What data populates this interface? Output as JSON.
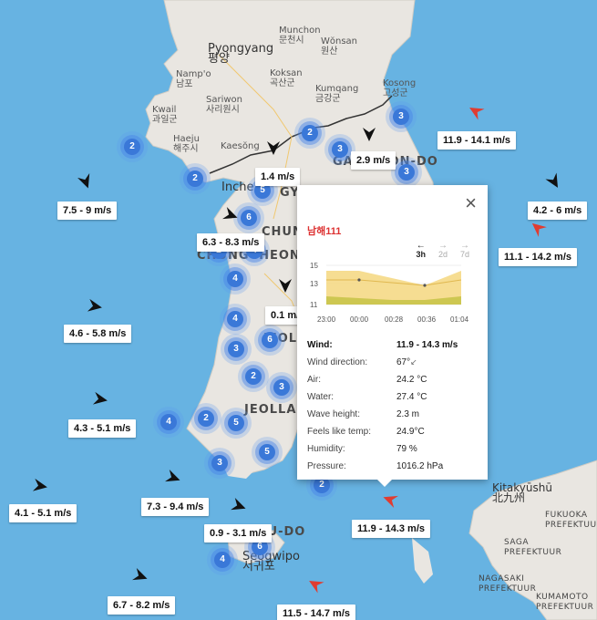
{
  "places": [
    {
      "id": "munchon",
      "text": "Munchon\n문천시",
      "cls": ""
    },
    {
      "id": "wonsan",
      "text": "Wŏnsan\n원산",
      "cls": ""
    },
    {
      "id": "pyongyang",
      "text": "Pyongyang\n평양",
      "cls": "big"
    },
    {
      "id": "nampo",
      "text": "Namp'o\n남포",
      "cls": ""
    },
    {
      "id": "koksan",
      "text": "Koksan\n곡산군",
      "cls": ""
    },
    {
      "id": "kosong",
      "text": "Kosong\n고성군",
      "cls": ""
    },
    {
      "id": "kwail",
      "text": "Kwail\n과일군",
      "cls": ""
    },
    {
      "id": "sariwon",
      "text": "Sariwon\n사리원시",
      "cls": ""
    },
    {
      "id": "kumgang",
      "text": "Kumqang\n금강군",
      "cls": ""
    },
    {
      "id": "haeju",
      "text": "Haeju\n해주시",
      "cls": ""
    },
    {
      "id": "kaesong",
      "text": "Kaesŏng",
      "cls": ""
    },
    {
      "id": "gangwon",
      "text": "GANGWON-DO",
      "cls": "region"
    },
    {
      "id": "incheon",
      "text": "Inche",
      "cls": "big"
    },
    {
      "id": "gyeonggi",
      "text": "GY",
      "cls": "region"
    },
    {
      "id": "chungcheong1",
      "text": "CHUN",
      "cls": "region"
    },
    {
      "id": "chungcheong2",
      "text": "CHUNGCHEONG",
      "cls": "region"
    },
    {
      "id": "jeolla1",
      "text": "JEOLL",
      "cls": "region"
    },
    {
      "id": "jeolla2",
      "text": "JEOLLAN",
      "cls": "region"
    },
    {
      "id": "jeju",
      "text": "JEJU-DO",
      "cls": "region"
    },
    {
      "id": "seogwipo",
      "text": "Seogwipo\n서귀포",
      "cls": "big"
    },
    {
      "id": "kitakyushu",
      "text": "Kitakyūshū\n北九州",
      "cls": "japan-city"
    },
    {
      "id": "fukuoka",
      "text": "FUKUOKA\nPREFEKTUUR",
      "cls": "japan"
    },
    {
      "id": "saga",
      "text": "SAGA\nPREFEKTUUR",
      "cls": "japan"
    },
    {
      "id": "nagasaki",
      "text": "NAGASAKI\nPREFEKTUUR",
      "cls": "japan"
    },
    {
      "id": "kumamoto",
      "text": "KUMAMOTO\nPREFEKTUUR",
      "cls": "japan"
    }
  ],
  "clusters": [
    "3",
    "2",
    "3",
    "2",
    "3",
    "2",
    "5",
    "6",
    "2",
    "4",
    "4",
    "4",
    "3",
    "6",
    "2",
    "3",
    "4",
    "2",
    "5",
    "3",
    "5",
    "2",
    "6",
    "4"
  ],
  "wind_labels": [
    "11.9 - 14.1 m/s",
    "2.9 m/s",
    "1.4 m/s",
    "7.5 - 9 m/s",
    "4.2 - 6 m/s",
    "6.3 - 8.3 m/s",
    "11.1 - 14.2 m/s",
    "0.1 m/s",
    "4.6 - 5.8 m/s",
    "4.3 - 5.1 m/s",
    "7.3 - 9.4 m/s",
    "4.1 - 5.1 m/s",
    "0.9 - 3.1 m/s",
    "11.9 - 14.3 m/s",
    "6.7 - 8.2 m/s",
    "11.5 - 14.7 m/s"
  ],
  "arrow_colors": {
    "normal": "#111111",
    "strong": "#e03c31"
  },
  "popup": {
    "title": "남해111",
    "close_icon": "×",
    "tabs": [
      {
        "arrow": "←",
        "label": "3h",
        "active": true
      },
      {
        "arrow": "→",
        "label": "2d",
        "active": false
      },
      {
        "arrow": "→",
        "label": "7d",
        "active": false
      }
    ],
    "chart": {
      "y_ticks": [
        "15",
        "13",
        "11"
      ],
      "x_ticks": [
        "23:00",
        "00:00",
        "00:28",
        "00:36",
        "01:04"
      ],
      "area_color": "#f5d77f",
      "lower_color": "#c9c44a"
    },
    "rows": [
      {
        "key": "Wind:",
        "value": "11.9 - 14.3 m/s",
        "bold": true
      },
      {
        "key": "Wind direction:",
        "value": "67°",
        "bold": false,
        "icon": "wind-direction-icon"
      },
      {
        "key": "Air:",
        "value": "24.2 °C",
        "bold": false
      },
      {
        "key": "Water:",
        "value": "27.4 °C",
        "bold": false
      },
      {
        "key": "Wave height:",
        "value": "2.3 m",
        "bold": false
      },
      {
        "key": "Feels like temp:",
        "value": "24.9°C",
        "bold": false
      },
      {
        "key": "Humidity:",
        "value": "79 %",
        "bold": false
      },
      {
        "key": "Pressure:",
        "value": "1016.2 hPa",
        "bold": false
      }
    ]
  }
}
